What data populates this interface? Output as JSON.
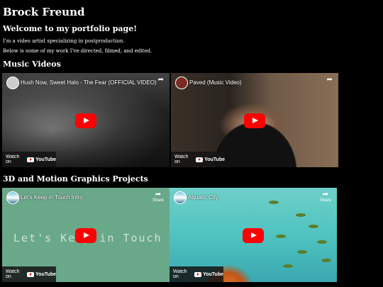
{
  "page": {
    "title": "Brock Freund",
    "welcome": "Welcome to my portfolio page!",
    "intro": "I'm a video artist specializing in postproduction.",
    "intro2": "Below is some of my work I've directed, filmed, and edited."
  },
  "sections": [
    {
      "heading": "Music Videos",
      "videos": [
        {
          "title": "Hush Now, Sweet Halo - The Fear (OFFICIAL VIDEO)",
          "watch_label": "Watch on",
          "yt_label": "YouTube"
        },
        {
          "title": "Paved (Music Video)",
          "watch_label": "Watch on",
          "yt_label": "YouTube"
        }
      ]
    },
    {
      "heading": "3D and Motion Graphics Projects",
      "videos": [
        {
          "title": "Let's Keep in Touch Intro",
          "watch_label": "Watch on",
          "yt_label": "YouTube",
          "share_label": "Share",
          "overlay_text": "Let's Keep in Touch"
        },
        {
          "title": "Aquatic City",
          "watch_label": "Watch on",
          "yt_label": "YouTube",
          "share_label": "Share"
        }
      ]
    }
  ],
  "icons": {
    "play": "play-button-icon",
    "share": "share-arrow-icon",
    "youtube": "youtube-logo-icon"
  },
  "colors": {
    "background": "#000000",
    "text": "#ffffff",
    "play_button": "#ff0000",
    "lkit_bg": "#6aa88a",
    "aquatic_bg": "#4fc3c0"
  }
}
